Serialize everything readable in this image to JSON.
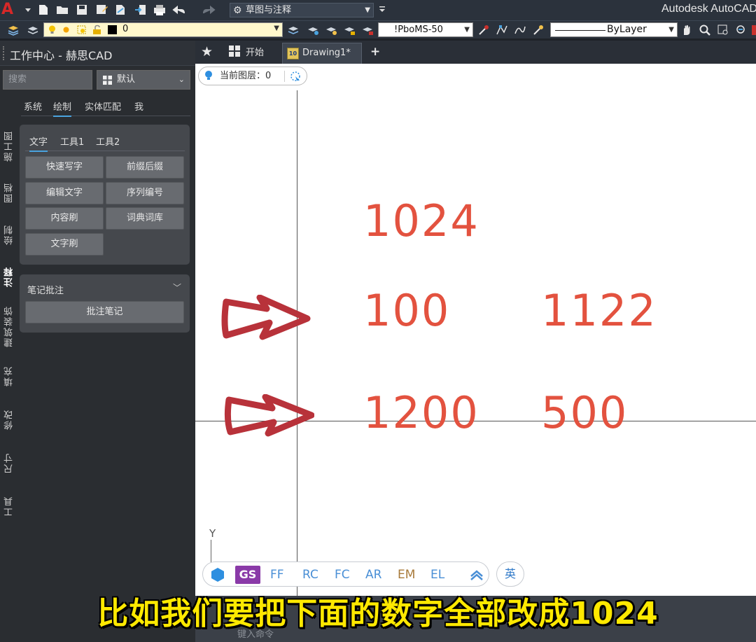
{
  "titlebar": {
    "logo_letter": "A",
    "workspace": "草图与注释",
    "app_title": "Autodesk AutoCAD"
  },
  "layer_toolbar": {
    "current_layer": "0",
    "dimstyle": "!PboMS-50",
    "linetype": "ByLayer"
  },
  "panel": {
    "title": "工作中心 - 赫思CAD",
    "search_placeholder": "搜索",
    "preset": "默认",
    "top_tabs": [
      "系统",
      "绘制",
      "实体匹配",
      "我"
    ],
    "active_top_tab": "绘制",
    "vertical_tabs": [
      "施工图",
      "图档",
      "绘制",
      "注释",
      "建筑装饰",
      "填充",
      "修改",
      "尺寸",
      "工具"
    ],
    "active_vertical_tab": "注释",
    "sub_tabs": [
      "文字",
      "工具1",
      "工具2"
    ],
    "active_sub_tab": "文字",
    "tool_buttons": [
      "快速写字",
      "前缀后缀",
      "编辑文字",
      "序列编号",
      "内容刷",
      "词典词库",
      "文字刷"
    ],
    "notes_title": "笔记批注",
    "notes_button": "批注笔记"
  },
  "doc_tabs": {
    "start": "开始",
    "drawing": "Drawing1*",
    "drawing_icon_text": "10"
  },
  "canvas": {
    "layer_pill": "当前图层：0",
    "ucs_y": "Y",
    "texts": [
      "1024",
      "100",
      "1122",
      "1200",
      "500"
    ],
    "snap_items": [
      "GS",
      "FF",
      "RC",
      "FC",
      "AR",
      "EM",
      "EL"
    ],
    "ime": "英",
    "command_prompt": "键入命令"
  },
  "subtitle": "比如我们要把下面的数字全部改成1024",
  "colors": {
    "cad_text": "#e3523f",
    "arrow_annotation": "#b8323a",
    "accent": "#4aa3df",
    "subtitle": "#ffe900"
  }
}
